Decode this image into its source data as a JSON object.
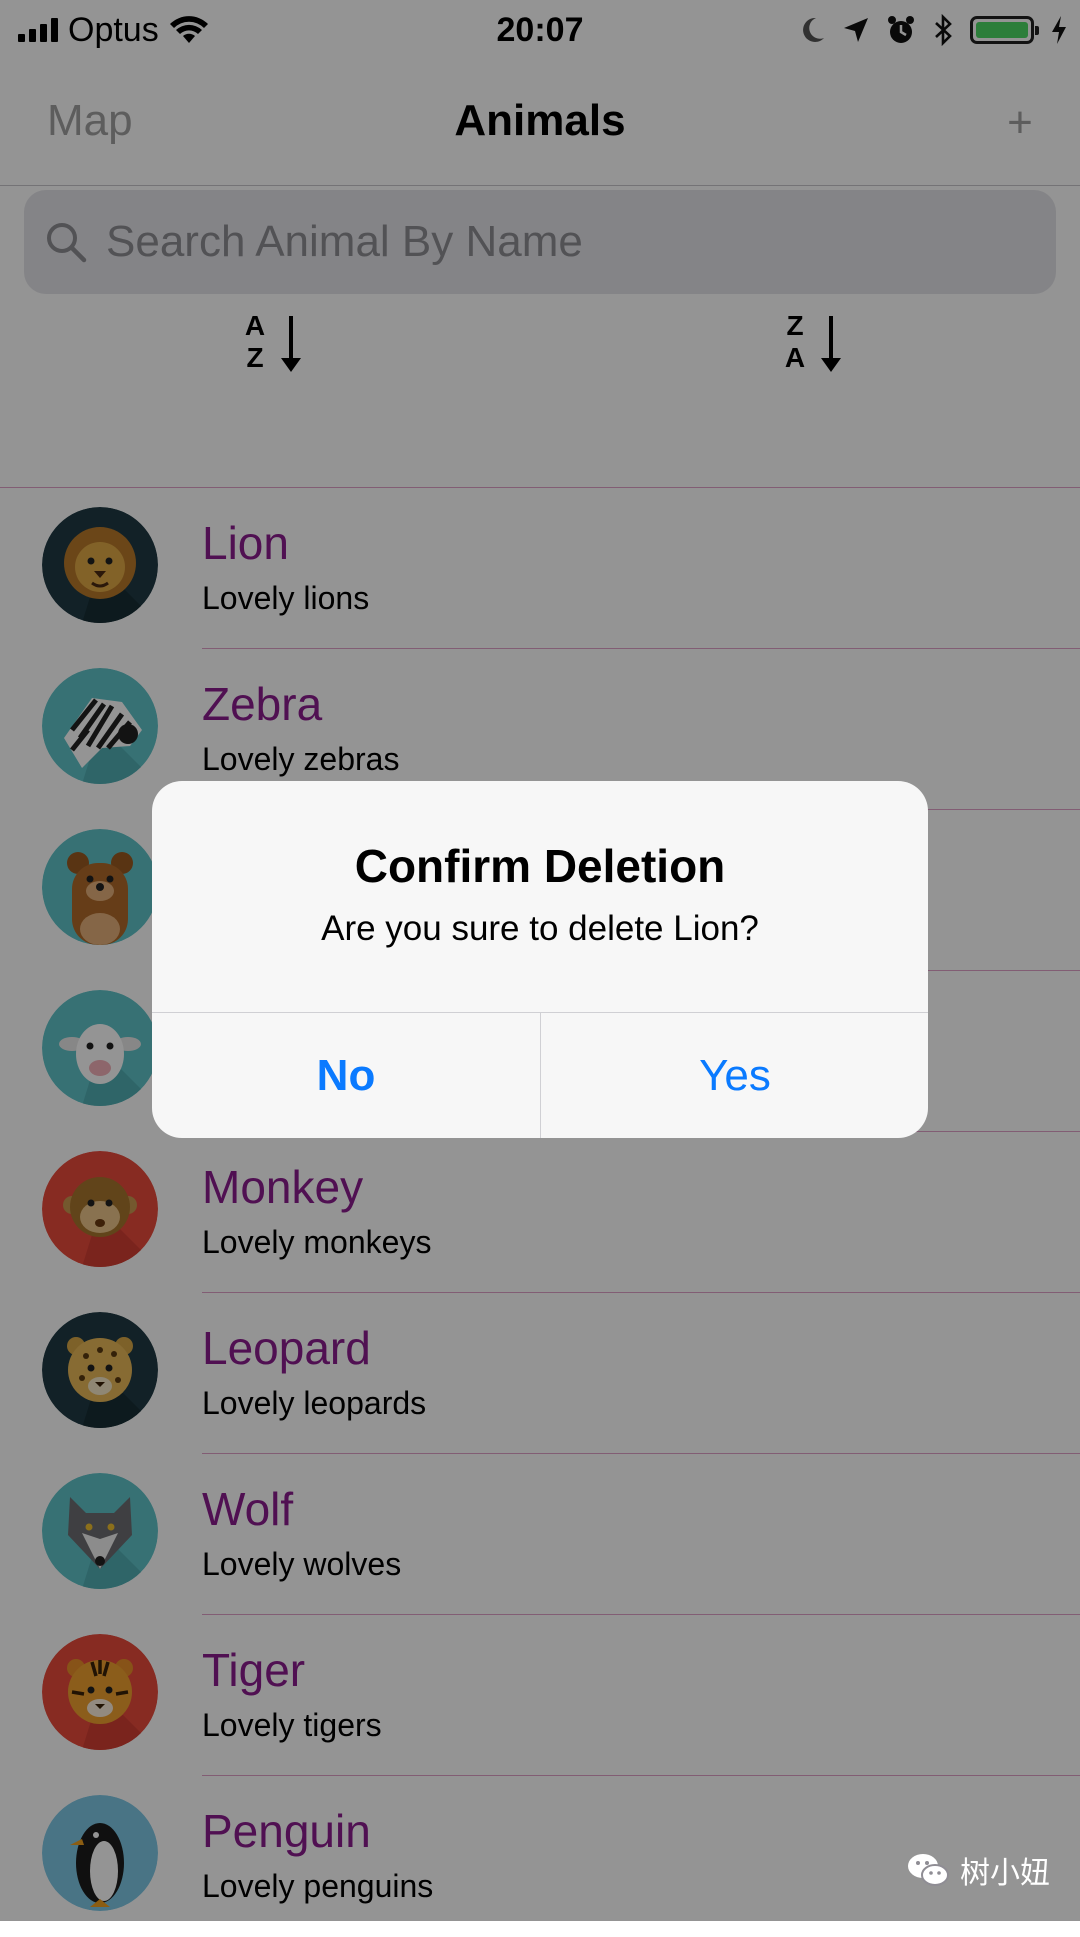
{
  "status_bar": {
    "carrier": "Optus",
    "time": "20:07",
    "battery_color": "#4cd964",
    "icons": [
      "signal-icon",
      "wifi-icon",
      "moon-icon",
      "location-arrow-icon",
      "alarm-icon",
      "bluetooth-icon",
      "battery-icon",
      "charging-bolt-icon"
    ]
  },
  "nav": {
    "left_button": "Map",
    "title": "Animals",
    "right_button": "+"
  },
  "search": {
    "placeholder": "Search Animal By Name",
    "value": ""
  },
  "sort": {
    "ascending": {
      "top": "A",
      "bottom": "Z"
    },
    "descending": {
      "top": "Z",
      "bottom": "A"
    }
  },
  "animals": [
    {
      "name": "Lion",
      "desc": "Lovely lions",
      "avatar_bg": "#1f3a44",
      "icon": "lion-icon"
    },
    {
      "name": "Zebra",
      "desc": "Lovely zebras",
      "avatar_bg": "#5fc3c9",
      "icon": "zebra-icon"
    },
    {
      "name": "",
      "desc": "",
      "avatar_bg": "#5fc3c9",
      "icon": "bear-icon"
    },
    {
      "name": "",
      "desc": "",
      "avatar_bg": "#5fc3c9",
      "icon": "sheep-icon"
    },
    {
      "name": "Monkey",
      "desc": "Lovely monkeys",
      "avatar_bg": "#e84a3c",
      "icon": "monkey-icon"
    },
    {
      "name": "Leopard",
      "desc": "Lovely leopards",
      "avatar_bg": "#1f3a44",
      "icon": "leopard-icon"
    },
    {
      "name": "Wolf",
      "desc": "Lovely wolves",
      "avatar_bg": "#5fc3c9",
      "icon": "wolf-icon"
    },
    {
      "name": "Tiger",
      "desc": "Lovely tigers",
      "avatar_bg": "#e84a3c",
      "icon": "tiger-icon"
    },
    {
      "name": "Penguin",
      "desc": "Lovely penguins",
      "avatar_bg": "#7fc8e6",
      "icon": "penguin-icon"
    }
  ],
  "alert": {
    "title": "Confirm Deletion",
    "message": "Are you sure to delete Lion?",
    "no_label": "No",
    "yes_label": "Yes",
    "accent": "#0a7aff"
  },
  "watermark": {
    "text": "树小妞",
    "icon": "wechat-icon"
  },
  "colors": {
    "name_text": "#8b1c8e",
    "separator": "#e0a0c8"
  }
}
